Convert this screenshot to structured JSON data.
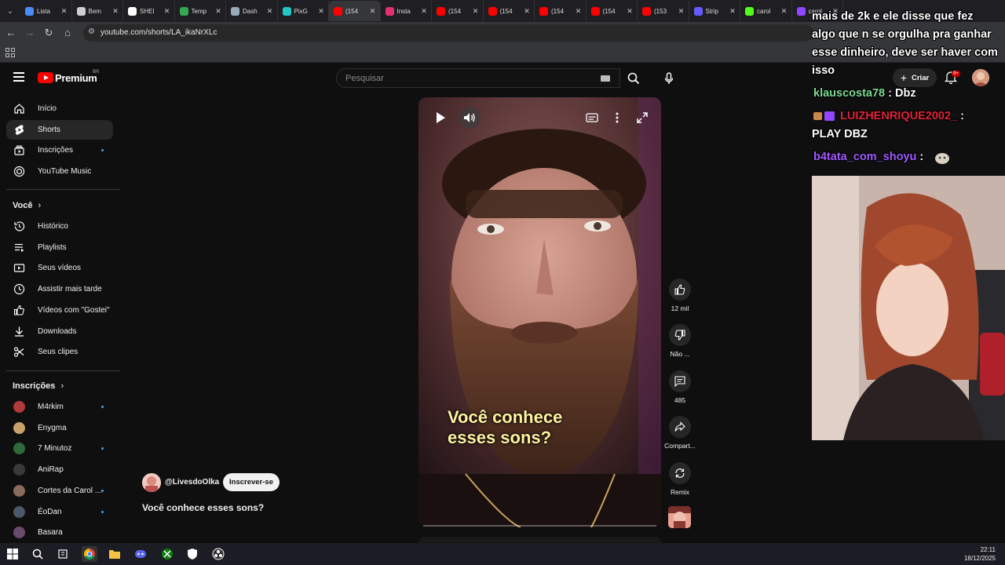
{
  "browser": {
    "tabs": [
      {
        "label": "Lista",
        "color": "#4b8bf5"
      },
      {
        "label": "Bem",
        "color": "#cfcfcf"
      },
      {
        "label": "SHEI",
        "color": "#ffffff"
      },
      {
        "label": "Temp",
        "color": "#34a853"
      },
      {
        "label": "Dash",
        "color": "#9ab"
      },
      {
        "label": "PixG",
        "color": "#21c6c6"
      },
      {
        "label": "(154",
        "color": "#ff0000",
        "active": true
      },
      {
        "label": "Insta",
        "color": "#e1306c"
      },
      {
        "label": "(154",
        "color": "#ff0000"
      },
      {
        "label": "(154",
        "color": "#ff0000"
      },
      {
        "label": "(154",
        "color": "#ff0000"
      },
      {
        "label": "(154",
        "color": "#ff0000"
      },
      {
        "label": "(153",
        "color": "#ff0000"
      },
      {
        "label": "Strip",
        "color": "#635bff"
      },
      {
        "label": "carol",
        "color": "#53fc18"
      },
      {
        "label": "carol",
        "color": "#9146ff"
      }
    ],
    "url": "youtube.com/shorts/LA_ikaNrXLc"
  },
  "header": {
    "logo_text": "Premium",
    "region": "BR",
    "search_placeholder": "Pesquisar",
    "create_label": "Criar",
    "notif_badge": "9+"
  },
  "sidebar": {
    "main": [
      {
        "label": "Início",
        "icon": "home-icon"
      },
      {
        "label": "Shorts",
        "icon": "shorts-icon",
        "active": true
      },
      {
        "label": "Inscrições",
        "icon": "subscriptions-icon",
        "dot": true
      },
      {
        "label": "YouTube Music",
        "icon": "youtube-music-icon"
      }
    ],
    "you_heading": "Você",
    "you": [
      {
        "label": "Histórico",
        "icon": "history-icon"
      },
      {
        "label": "Playlists",
        "icon": "playlists-icon"
      },
      {
        "label": "Seus vídeos",
        "icon": "your-videos-icon"
      },
      {
        "label": "Assistir mais tarde",
        "icon": "watch-later-icon"
      },
      {
        "label": "Vídeos com \"Gostei\"",
        "icon": "liked-icon"
      },
      {
        "label": "Downloads",
        "icon": "downloads-icon"
      },
      {
        "label": "Seus clipes",
        "icon": "clips-icon"
      }
    ],
    "subs_heading": "Inscrições",
    "subscriptions": [
      {
        "label": "M4rkim",
        "color": "#b33a3a",
        "dot": true
      },
      {
        "label": "Enygma",
        "color": "#c9a26b",
        "dot": false
      },
      {
        "label": "7 Minutoz",
        "color": "#2f6b3a",
        "dot": true
      },
      {
        "label": "AniRap",
        "color": "#3a3a3a",
        "dot": false
      },
      {
        "label": "Cortes da Carol ...",
        "color": "#8a6a5a",
        "dot": true
      },
      {
        "label": "ÉoDan",
        "color": "#4a5a6a",
        "dot": true
      },
      {
        "label": "Basara",
        "color": "#6a4a6a",
        "dot": false
      }
    ]
  },
  "short": {
    "caption_line1": "Você conhece",
    "caption_line2": "esses sons?",
    "channel": "@LivesdoOlka",
    "subscribe_label": "Inscrever-se",
    "title": "Você conhece esses sons?",
    "progress": 0.0
  },
  "actions": {
    "like_count": "12 mil",
    "dislike_label": "Não ...",
    "comments_count": "485",
    "share_label": "Compart...",
    "remix_label": "Remix"
  },
  "overlay": {
    "chat": [
      {
        "user": "",
        "text": "mais de 2k e ele disse que fez",
        "color": "#ffffff"
      },
      {
        "user": "",
        "text": "algo que n se orgulha pra ganhar",
        "color": "#ffffff"
      },
      {
        "user": "",
        "text": "esse dinheiro, deve ser haver com",
        "color": "#ffffff"
      },
      {
        "user": "",
        "text": "isso",
        "color": "#ffffff"
      },
      {
        "user": "klauscosta78",
        "text": "Dbz",
        "color": "#7cd992"
      },
      {
        "user": "LUIZHENRIQUE2002_",
        "text": "",
        "color": "#e0243a"
      },
      {
        "user": "",
        "text": "PLAY DBZ",
        "color": "#ffffff"
      },
      {
        "user": "b4tata_com_shoyu",
        "text": "",
        "color": "#a259ff"
      }
    ]
  },
  "taskbar": {
    "time": "22:11",
    "date": "18/12/2025"
  }
}
